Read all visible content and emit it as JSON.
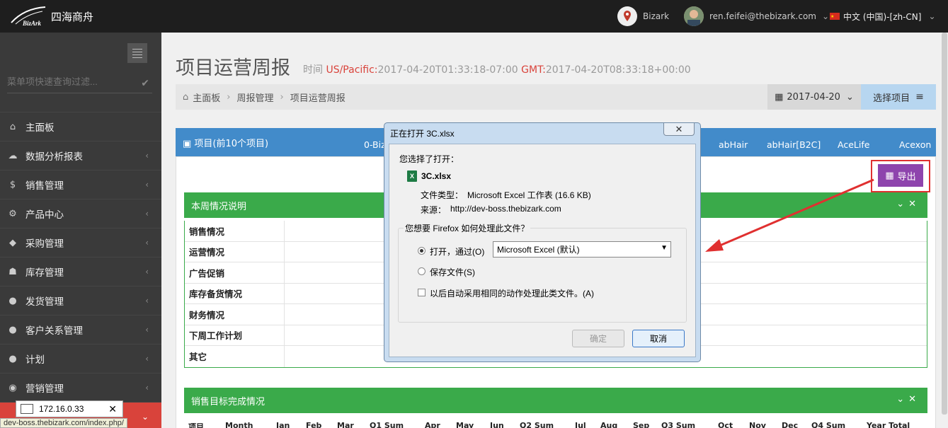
{
  "brand": {
    "name": "四海商舟",
    "mark_text": "BizArk"
  },
  "topbar": {
    "company": "Bizark",
    "user_email": "ren.feifei@thebizark.com",
    "language": "中文 (中国)-[zh-CN]"
  },
  "sidebar": {
    "filter_placeholder": "菜单项快速查询过滤...",
    "items": [
      {
        "label": "主面板",
        "icon": "home-icon"
      },
      {
        "label": "数据分析报表",
        "icon": "cloud-icon"
      },
      {
        "label": "销售管理",
        "icon": "dollar-icon"
      },
      {
        "label": "产品中心",
        "icon": "cogs-icon"
      },
      {
        "label": "采购管理",
        "icon": "cube-icon"
      },
      {
        "label": "库存管理",
        "icon": "android-icon"
      },
      {
        "label": "发货管理",
        "icon": "circle-icon"
      },
      {
        "label": "客户关系管理",
        "icon": "circle-icon"
      },
      {
        "label": "计划",
        "icon": "circle-icon"
      },
      {
        "label": "营销管理",
        "icon": "circle-outline-icon"
      }
    ]
  },
  "browser": {
    "ip_popup": "172.16.0.33",
    "status_url": "dev-boss.thebizark.com/index.php/"
  },
  "page": {
    "title": "项目运营周报",
    "time_label": "时间",
    "tz_pacific": "US/Pacific:",
    "time_pacific": "2017-04-20T01:33:18-07:00",
    "tz_gmt": "GMT:",
    "time_gmt": "2017-04-20T08:33:18+00:00"
  },
  "breadcrumb": {
    "home": "主面板",
    "level2": "周报管理",
    "current": "项目运营周报"
  },
  "toolbar": {
    "date": "2017-04-20",
    "select_project": "选择项目"
  },
  "projects": {
    "title": "项目(前10个项目)",
    "tabs": [
      "0-Biz",
      "abHair",
      "abHair[B2C]",
      "AceLife",
      "Acexon"
    ]
  },
  "export_label": "导出",
  "summary": {
    "title": "本周情况说明",
    "rows": [
      "销售情况",
      "运营情况",
      "广告促销",
      "库存备货情况",
      "财务情况",
      "下周工作计划",
      "其它"
    ]
  },
  "sales_target": {
    "title": "销售目标完成情况",
    "columns": [
      "项目",
      "Month",
      "Jan",
      "Feb",
      "Mar",
      "Q1 Sum",
      "Apr",
      "May",
      "Jun",
      "Q2 Sum",
      "Jul",
      "Aug",
      "Sep",
      "Q3 Sum",
      "Oct",
      "Nov",
      "Dec",
      "Q4 Sum",
      "Year Total"
    ]
  },
  "dialog": {
    "title": "正在打开 3C.xlsx",
    "chose_label": "您选择了打开：",
    "filename": "3C.xlsx",
    "filetype_label": "文件类型：",
    "filetype_value": "Microsoft Excel 工作表 (16.6 KB)",
    "source_label": "来源：",
    "source_value": "http://dev-boss.thebizark.com",
    "question": "您想要 Firefox 如何处理此文件？",
    "open_with": "打开，通过(O)",
    "app": "Microsoft Excel (默认)",
    "save_file": "保存文件(S)",
    "auto_action": "以后自动采用相同的动作处理此类文件。(A)",
    "ok": "确定",
    "cancel": "取消"
  }
}
